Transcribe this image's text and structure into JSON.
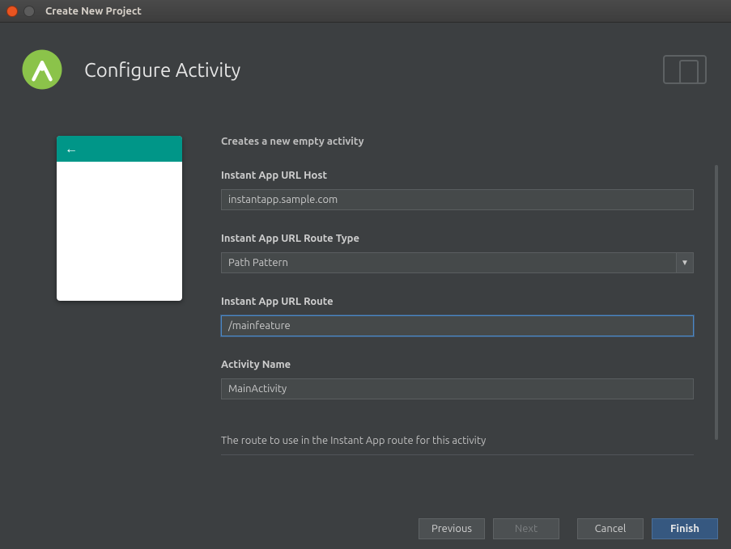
{
  "window": {
    "title": "Create New Project"
  },
  "header": {
    "title": "Configure Activity"
  },
  "form": {
    "description": "Creates a new empty activity",
    "url_host": {
      "label": "Instant App URL Host",
      "value": "instantapp.sample.com"
    },
    "route_type": {
      "label": "Instant App URL Route Type",
      "value": "Path Pattern"
    },
    "url_route": {
      "label": "Instant App URL Route",
      "value": "/mainfeature"
    },
    "activity_name": {
      "label": "Activity Name",
      "value": "MainActivity"
    },
    "hint": "The route to use in the Instant App route for this activity"
  },
  "footer": {
    "previous": "Previous",
    "next": "Next",
    "cancel": "Cancel",
    "finish": "Finish"
  }
}
